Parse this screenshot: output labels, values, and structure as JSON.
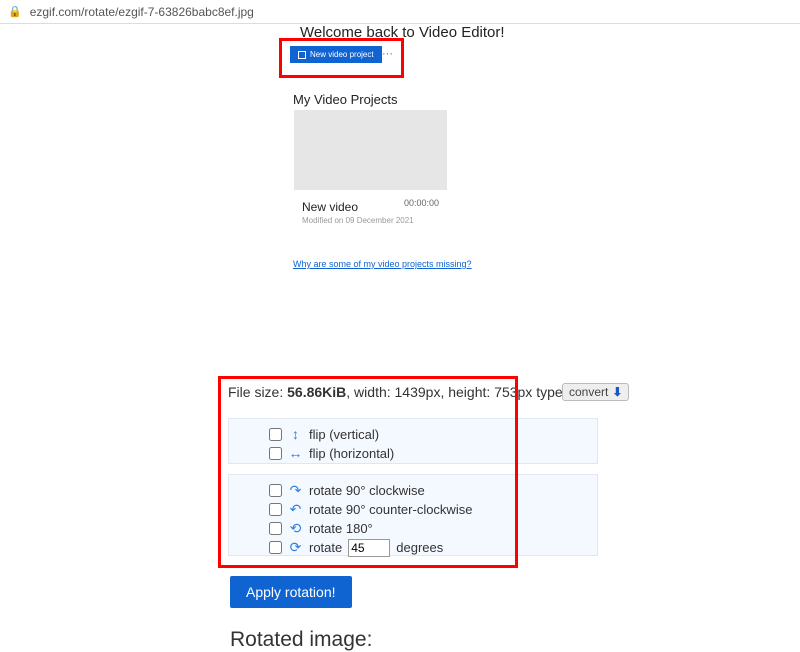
{
  "url": "ezgif.com/rotate/ezgif-7-63826babc8ef.jpg",
  "screenshot": {
    "welcome": "Welcome back to Video Editor!",
    "new_video_btn": "New video project",
    "ellipsis": "···",
    "projects_heading": "My Video Projects",
    "project": {
      "title": "New video",
      "duration": "00:00:00",
      "modified": "Modified on 09 December 2021"
    },
    "missing_link": "Why are some of my video projects missing?"
  },
  "file_info": {
    "prefix": "File size: ",
    "size": "56.86KiB",
    "width_label": ", width: 1439px, height: 753px",
    "type_label": " type: jpg",
    "convert_label": "convert"
  },
  "options": {
    "flip_v": "flip (vertical)",
    "flip_h": "flip (horizontal)",
    "rot_cw": "rotate 90° clockwise",
    "rot_ccw": "rotate 90° counter-clockwise",
    "rot_180": "rotate 180°",
    "rot_custom_prefix": "rotate",
    "rot_custom_val": "45",
    "rot_custom_suffix": "degrees"
  },
  "apply_label": "Apply rotation!",
  "rotated_heading": "Rotated image:"
}
